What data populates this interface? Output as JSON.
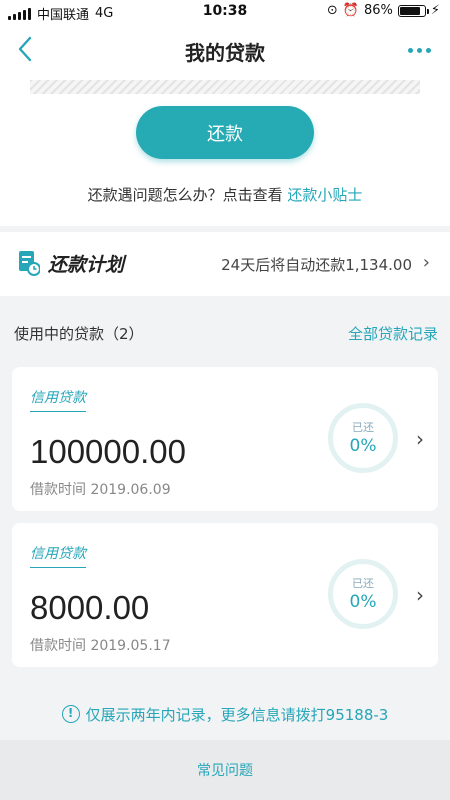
{
  "status_bar": {
    "carrier": "中国联通",
    "network": "4G",
    "time": "10:38",
    "battery": "86%",
    "battery_level": 0.86
  },
  "header": {
    "title": "我的贷款",
    "back_icon": "chevron-left-icon",
    "more_icon": "more-dots-icon"
  },
  "repay": {
    "button_label": "还款",
    "help_text": "还款遇问题怎么办？点击查看 ",
    "help_link": "还款小贴士"
  },
  "plan": {
    "title": "还款计划",
    "description": "24天后将自动还款1,134.00",
    "arrow": "›"
  },
  "loans": {
    "section_label": "使用中的贷款（2）",
    "all_records": "全部贷款记录",
    "items": [
      {
        "tag": "信用贷款",
        "amount": "100000.00",
        "date": "借款时间 2019.06.09",
        "progress_label": "已还",
        "progress": "0%"
      },
      {
        "tag": "信用贷款",
        "amount": "8000.00",
        "date": "借款时间 2019.05.17",
        "progress_label": "已还",
        "progress": "0%"
      }
    ]
  },
  "notice": {
    "text": "仅展示两年内记录，更多信息请拨打95188-3"
  },
  "footer": {
    "faq": "常见问题"
  },
  "colors": {
    "accent": "#26a6b8",
    "button": "#26aab4"
  }
}
